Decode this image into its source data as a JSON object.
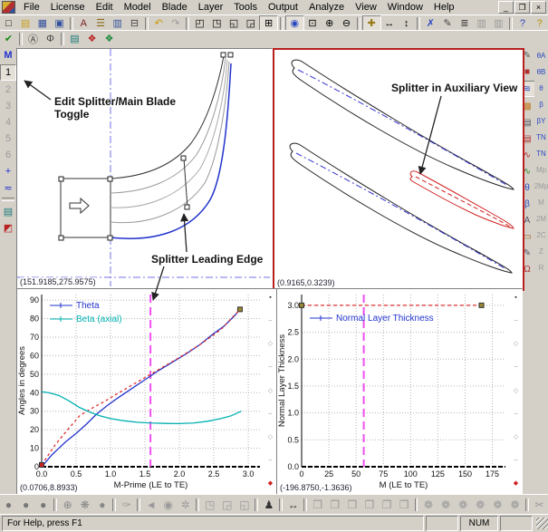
{
  "window": {
    "menu": [
      "File",
      "License",
      "Edit",
      "Model",
      "Blade",
      "Layer",
      "Tools",
      "Output",
      "Analyze",
      "View",
      "Window",
      "Help"
    ],
    "controls": [
      {
        "name": "minimize",
        "glyph": "_"
      },
      {
        "name": "restore",
        "glyph": "❐"
      },
      {
        "name": "close",
        "glyph": "×"
      }
    ]
  },
  "toolbars": {
    "main_groups": [
      [
        {
          "name": "new",
          "glyph": "□"
        },
        {
          "name": "open",
          "glyph": "▤",
          "color": "#c8a01e"
        },
        {
          "name": "save",
          "glyph": "▦",
          "color": "#33519e"
        },
        {
          "name": "save-all",
          "glyph": "▣",
          "color": "#33519e"
        }
      ],
      [
        {
          "name": "find",
          "glyph": "A",
          "color": "#7a1f1f"
        },
        {
          "name": "blade-manager",
          "glyph": "☰",
          "color": "#8a6a1a"
        },
        {
          "name": "table-editor",
          "glyph": "▥",
          "color": "#33519e"
        },
        {
          "name": "print",
          "glyph": "⊟",
          "color": "#444"
        }
      ],
      [
        {
          "name": "undo",
          "glyph": "↶",
          "color": "#c89a00"
        },
        {
          "name": "redo",
          "glyph": "↷",
          "color": "#9a9a9a"
        }
      ],
      [
        {
          "name": "window-top-left",
          "glyph": "◰"
        },
        {
          "name": "window-top-right",
          "glyph": "◳"
        },
        {
          "name": "window-bottom-left",
          "glyph": "◱"
        },
        {
          "name": "window-bottom-right",
          "glyph": "◲"
        },
        {
          "name": "window-grid",
          "glyph": "⊞",
          "active": true
        }
      ],
      [
        {
          "name": "fit-view",
          "glyph": "◉",
          "color": "#2b48c0",
          "active": true
        },
        {
          "name": "zoom-window",
          "glyph": "⊡"
        },
        {
          "name": "zoom-in",
          "glyph": "⊕"
        },
        {
          "name": "zoom-out",
          "glyph": "⊖"
        }
      ],
      [
        {
          "name": "pan",
          "glyph": "✚",
          "color": "#9a7a1a",
          "active": true
        },
        {
          "name": "stretch-horizontal",
          "glyph": "↔"
        },
        {
          "name": "stretch-vertical",
          "glyph": "↕"
        }
      ],
      [
        {
          "name": "delete-point",
          "glyph": "✗",
          "color": "#2b48c0"
        },
        {
          "name": "edit-point",
          "glyph": "✎",
          "color": "#444"
        },
        {
          "name": "layer-stack",
          "glyph": "≣",
          "color": "#444"
        },
        {
          "name": "worksheet-1",
          "glyph": "▥",
          "disabled": true
        },
        {
          "name": "worksheet-2",
          "glyph": "▥",
          "disabled": true
        }
      ],
      [
        {
          "name": "context-help",
          "glyph": "?",
          "color": "#2b48c0"
        },
        {
          "name": "help-topics",
          "glyph": "?",
          "color": "#b89000"
        }
      ]
    ],
    "edit_groups": [
      [
        {
          "name": "apply-changes",
          "glyph": "✔",
          "color": "#1a8a1a"
        }
      ],
      [
        {
          "name": "audit",
          "glyph": "Ⓐ",
          "color": "#444"
        },
        {
          "name": "units-balance",
          "glyph": "Φ",
          "color": "#444"
        }
      ],
      [
        {
          "name": "properties",
          "glyph": "▤",
          "color": "#1a7a7a"
        },
        {
          "name": "blade-solid-toggle",
          "glyph": "❖",
          "color": "#bb2222"
        },
        {
          "name": "splitter-solid-toggle",
          "glyph": "❖",
          "color": "#1a8a3a"
        }
      ]
    ],
    "left_items": [
      {
        "name": "main-blade-toggle",
        "glyph": "M",
        "color": "#2233cc"
      },
      {
        "name": "layer-1",
        "glyph": "1",
        "active": true
      },
      {
        "name": "layer-2",
        "glyph": "2",
        "disabled": true
      },
      {
        "name": "layer-3",
        "glyph": "3",
        "disabled": true
      },
      {
        "name": "layer-4",
        "glyph": "4",
        "disabled": true
      },
      {
        "name": "layer-5",
        "glyph": "5",
        "disabled": true
      },
      {
        "name": "layer-6",
        "glyph": "6",
        "disabled": true
      },
      {
        "name": "add-layer",
        "glyph": "+",
        "color": "#2233cc"
      },
      {
        "name": "merge-layer",
        "glyph": "≂",
        "color": "#2233cc"
      },
      {
        "name": "sep",
        "sep": true
      },
      {
        "name": "layer-properties",
        "glyph": "▤",
        "color": "#1a7a7a"
      },
      {
        "name": "layer-display",
        "glyph": "◩",
        "color": "#bb2222"
      }
    ],
    "right_inner_items": [
      {
        "name": "sketch-view",
        "glyph": "✎",
        "color": "#555"
      },
      {
        "name": "3d-view",
        "glyph": "■",
        "color": "#b03030"
      },
      {
        "name": "blade-to-blade-view",
        "glyph": "≋",
        "color": "#2b48c0",
        "active": true
      },
      {
        "name": "contour-view",
        "glyph": "▩",
        "color": "#c07820"
      },
      {
        "name": "report-view",
        "glyph": "▤",
        "color": "#556"
      },
      {
        "name": "data-report-view",
        "glyph": "▤",
        "color": "#b03030"
      },
      {
        "name": "angle-plot-red",
        "glyph": "∿",
        "color": "#b03030"
      },
      {
        "name": "angle-plot-green",
        "glyph": "∿",
        "color": "#2a8a2a"
      },
      {
        "name": "theta-plot-view",
        "glyph": "θ",
        "color": "#2b48c0"
      },
      {
        "name": "beta-plot-view",
        "glyph": "β",
        "color": "#2b48c0"
      },
      {
        "name": "bla-view",
        "glyph": "A",
        "color": "#556"
      },
      {
        "name": "solid-view",
        "glyph": "▭",
        "color": "#96642a"
      },
      {
        "name": "edit-curve",
        "glyph": "✎",
        "color": "#556"
      },
      {
        "name": "red-curve",
        "glyph": "Ω",
        "color": "#b03030"
      }
    ],
    "right_outer_items": [
      {
        "name": "plot-theta-a",
        "glyph": "θA",
        "color": "#2b48c0"
      },
      {
        "name": "plot-theta-b",
        "glyph": "θB",
        "color": "#2b48c0"
      },
      {
        "name": "plot-theta",
        "glyph": "θ",
        "color": "#2b48c0"
      },
      {
        "name": "plot-beta",
        "glyph": "β",
        "color": "#2b48c0"
      },
      {
        "name": "plot-beta-y",
        "glyph": "βY",
        "color": "#2b48c0"
      },
      {
        "name": "plot-tn-1",
        "glyph": "TN",
        "color": "#2b48c0"
      },
      {
        "name": "plot-tn-2",
        "glyph": "TN",
        "color": "#2b48c0"
      },
      {
        "name": "axis-mp",
        "glyph": "Mp",
        "disabled": true
      },
      {
        "name": "axis-2mp",
        "glyph": "2Mp",
        "disabled": true
      },
      {
        "name": "axis-m",
        "glyph": "M",
        "disabled": true
      },
      {
        "name": "axis-2m",
        "glyph": "2M",
        "disabled": true
      },
      {
        "name": "axis-2c",
        "glyph": "2C",
        "disabled": true
      },
      {
        "name": "axis-z",
        "glyph": "Z",
        "disabled": true
      },
      {
        "name": "axis-r",
        "glyph": "R",
        "disabled": true
      }
    ],
    "bottom_groups": [
      [
        {
          "name": "shade-mode-1",
          "glyph": "●",
          "color": "#777"
        },
        {
          "name": "shade-mode-2",
          "glyph": "●",
          "color": "#777"
        },
        {
          "name": "shade-mode-3",
          "glyph": "●",
          "color": "#777"
        }
      ],
      [
        {
          "name": "sphere-wire",
          "glyph": "⊕",
          "color": "#888"
        },
        {
          "name": "sphere-mesh",
          "glyph": "❋",
          "color": "#888"
        },
        {
          "name": "sphere-solid",
          "glyph": "●",
          "color": "#888"
        }
      ],
      [
        {
          "name": "ink-tool",
          "glyph": "✑",
          "color": "#999",
          "disabled": true
        }
      ],
      [
        {
          "name": "rotate-view",
          "glyph": "◄",
          "disabled": true
        },
        {
          "name": "orbit-view",
          "glyph": "◉",
          "disabled": true
        },
        {
          "name": "spin-view",
          "glyph": "✲",
          "disabled": true
        }
      ],
      [
        {
          "name": "axis-box-x",
          "glyph": "◳",
          "disabled": true
        },
        {
          "name": "axis-box-y",
          "glyph": "◲",
          "disabled": true
        },
        {
          "name": "axis-box-z",
          "glyph": "◱",
          "disabled": true
        }
      ],
      [
        {
          "name": "figure-view",
          "glyph": "♟",
          "color": "#333"
        }
      ],
      [
        {
          "name": "span-horizontal",
          "glyph": "↔",
          "color": "#333"
        }
      ],
      [
        {
          "name": "surface-tool-1",
          "glyph": "❒",
          "disabled": true
        },
        {
          "name": "surface-tool-2",
          "glyph": "❒",
          "disabled": true
        },
        {
          "name": "surface-tool-3",
          "glyph": "❒",
          "disabled": true
        },
        {
          "name": "surface-tool-4",
          "glyph": "❒",
          "disabled": true
        },
        {
          "name": "surface-tool-5",
          "glyph": "❒",
          "disabled": true
        },
        {
          "name": "surface-tool-6",
          "glyph": "❒",
          "disabled": true
        }
      ],
      [
        {
          "name": "mesh-tool-1",
          "glyph": "❁",
          "disabled": true
        },
        {
          "name": "mesh-tool-2",
          "glyph": "❁",
          "disabled": true
        },
        {
          "name": "mesh-tool-3",
          "glyph": "❁",
          "disabled": true
        },
        {
          "name": "mesh-tool-4",
          "glyph": "❁",
          "disabled": true
        },
        {
          "name": "mesh-tool-5",
          "glyph": "❁",
          "disabled": true
        },
        {
          "name": "mesh-tool-6",
          "glyph": "❁",
          "disabled": true
        }
      ],
      [
        {
          "name": "cut-tool",
          "glyph": "✂",
          "disabled": true
        }
      ]
    ]
  },
  "annotations": {
    "edit_toggle_1": "Edit Splitter/Main Blade",
    "edit_toggle_2": "Toggle",
    "splitter_le": "Splitter Leading Edge",
    "aux": "Splitter in Auxiliary View"
  },
  "panes": {
    "meridional": {
      "coord": "(151.9185,275.9575)"
    },
    "auxiliary": {
      "coord": "(0.9165,0.3239)"
    },
    "angles_chart": {
      "coord": "(0.0706,8.8933)"
    },
    "thickness_chart": {
      "coord": "(-196.8750,-1.3636)"
    }
  },
  "edge_markers": [
    {
      "g": "▪",
      "c": "#222"
    },
    {
      "g": "–",
      "c": "#999"
    },
    {
      "g": "◇",
      "c": "#999"
    },
    {
      "g": "–",
      "c": "#999"
    },
    {
      "g": "◇",
      "c": "#999"
    },
    {
      "g": "–",
      "c": "#999"
    },
    {
      "g": "◇",
      "c": "#999"
    },
    {
      "g": "–",
      "c": "#999"
    },
    {
      "g": "◆",
      "c": "#d02020"
    }
  ],
  "chart_data": [
    {
      "id": "angles-chart",
      "type": "line",
      "title": "",
      "xlabel": "M-Prime (LE to TE)",
      "ylabel": "Angles in degrees",
      "xlim": [
        0,
        3.17
      ],
      "ylim": [
        0,
        93
      ],
      "grid": true,
      "legend_position": "top-left",
      "xticks": [
        0.0,
        0.5,
        1.0,
        1.5,
        2.0,
        2.5,
        3.0
      ],
      "xtick_labels": [
        "0.0",
        "0.5",
        "1.0",
        "1.5",
        "2.0",
        "2.5",
        "3.0"
      ],
      "yticks": [
        0,
        10,
        20,
        30,
        40,
        50,
        60,
        70,
        80,
        90
      ],
      "ytick_labels": [
        "0",
        "10",
        "20",
        "30",
        "40",
        "50",
        "60",
        "70",
        "80",
        "90"
      ],
      "vline": {
        "x": 1.58,
        "color": "#f050f0"
      },
      "legend_dy": 12,
      "series": [
        {
          "label": "Theta",
          "color": "#2233cc",
          "dash": null,
          "x": [
            0,
            0.07,
            0.15,
            0.25,
            0.35,
            0.5,
            0.65,
            0.8,
            0.95,
            1.1,
            1.3,
            1.5,
            1.7,
            1.9,
            2.1,
            2.3,
            2.5,
            2.65,
            2.8,
            2.88
          ],
          "y": [
            0,
            3,
            6.5,
            10,
            13.5,
            18,
            23,
            28.5,
            33,
            37,
            42,
            47,
            52,
            56.5,
            61,
            66,
            72,
            76,
            81.5,
            85
          ],
          "markers": [
            {
              "x": 2.88,
              "y": 85,
              "color": "#998833"
            }
          ]
        },
        {
          "label": "",
          "color": "#e03030",
          "dash": "3,3",
          "x": [
            0,
            0.2,
            0.4,
            0.55,
            0.7,
            0.9,
            1.1,
            1.4,
            1.7,
            2.0,
            2.3,
            2.6,
            2.88
          ],
          "y": [
            1,
            12,
            21,
            27.5,
            31,
            35,
            39.5,
            46,
            52.5,
            59,
            66,
            74,
            85
          ],
          "markers": [
            {
              "x": 0,
              "y": 1,
              "color": "#cc2222"
            }
          ]
        },
        {
          "label": "Beta (axial)",
          "color": "#00b0b0",
          "dash": null,
          "x": [
            0,
            0.1,
            0.25,
            0.4,
            0.55,
            0.7,
            0.85,
            1.0,
            1.2,
            1.4,
            1.6,
            1.8,
            2.0,
            2.2,
            2.4,
            2.6,
            2.75,
            2.9
          ],
          "y": [
            40.5,
            40,
            38.5,
            35.5,
            32,
            29.5,
            27.5,
            26,
            24.8,
            24,
            23.6,
            23.4,
            23.3,
            23.6,
            24.5,
            26,
            27.5,
            30
          ]
        }
      ]
    },
    {
      "id": "thickness-chart",
      "type": "line",
      "title": "",
      "xlabel": "M (LE to TE)",
      "ylabel": "Normal Layer Thickness",
      "xlim": [
        0,
        187
      ],
      "ylim": [
        0,
        3.2
      ],
      "grid": true,
      "legend_position": "top-left",
      "xticks": [
        0,
        25,
        50,
        75,
        100,
        125,
        150,
        175
      ],
      "xtick_labels": [
        "0",
        "25",
        "50",
        "75",
        "100",
        "125",
        "150",
        "175"
      ],
      "yticks": [
        0.0,
        0.5,
        1.0,
        1.5,
        2.0,
        2.5,
        3.0
      ],
      "ytick_labels": [
        "0.0",
        "0.5",
        "1.0",
        "1.5",
        "2.0",
        "2.5",
        "3.0"
      ],
      "vline": {
        "x": 57,
        "color": "#f050f0"
      },
      "legend_dy": 26,
      "series": [
        {
          "label": "Normal Layer Thickness",
          "color": "#2233cc",
          "dash": null,
          "x": [],
          "y": []
        },
        {
          "label": "",
          "color": "#e03030",
          "dash": "4,3",
          "x": [
            0,
            165
          ],
          "y": [
            3.0,
            3.0
          ],
          "markers": [
            {
              "x": 0,
              "y": 3.0,
              "color": "#998833"
            },
            {
              "x": 165,
              "y": 3.0,
              "color": "#998833"
            }
          ]
        }
      ]
    }
  ],
  "statusbar": {
    "help": "For Help, press F1",
    "num": "NUM",
    "boxes": [
      "",
      "NUM",
      ""
    ]
  }
}
